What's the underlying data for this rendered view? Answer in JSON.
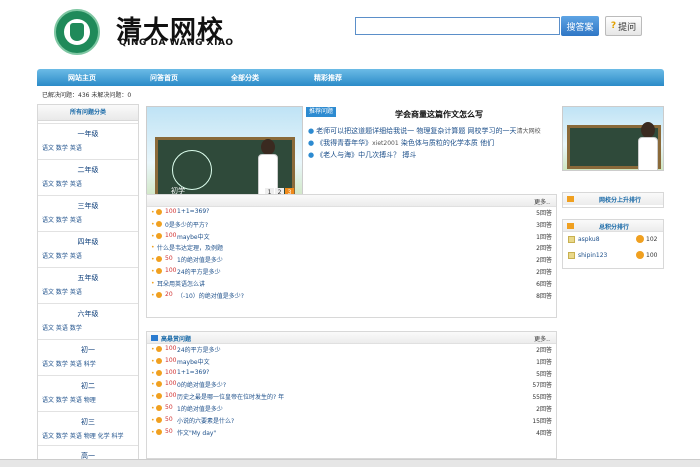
{
  "header": {
    "brand_cn": "清大网校",
    "brand_en": "QING DA WANG XIAO",
    "search_placeholder": "",
    "search_button": "搜答案",
    "ask_button": "提问"
  },
  "nav": [
    "网站主页",
    "问答首页",
    "全部分类",
    "精彩推荐"
  ],
  "stats": "已解决问题：436  未解决问题：0",
  "sidebar": {
    "title": "所有问题分类",
    "grades": [
      {
        "name": "一年级",
        "subjects": "语文 数学 英语"
      },
      {
        "name": "二年级",
        "subjects": "语文 数学 英语"
      },
      {
        "name": "三年级",
        "subjects": "语文 数学 英语"
      },
      {
        "name": "四年级",
        "subjects": "语文 数学 英语"
      },
      {
        "name": "五年级",
        "subjects": "语文 数学 英语"
      },
      {
        "name": "六年级",
        "subjects": "语文 英语 数学"
      },
      {
        "name": "初一",
        "subjects": "语文 数学 英语 科学"
      },
      {
        "name": "初二",
        "subjects": "语文 数学 英语 物理"
      },
      {
        "name": "初三",
        "subjects": "语文 数学 英语 物理 化学 科学"
      },
      {
        "name": "高一",
        "subjects": ""
      }
    ]
  },
  "banner": {
    "caption": "初学",
    "pages": [
      "1",
      "2",
      "3"
    ]
  },
  "recommend": {
    "tag": "推荐问题",
    "title": "学会商量这篇作文怎么写",
    "lines": [
      {
        "text": "老师可以把这道题详细给我说一 物理复杂计算题 网校学习的一天",
        "extra": "清大网校"
      },
      {
        "text": "《我得青春年华》",
        "extra": "xiet2001",
        "text2": "染色体与质粒的化学本质 他们"
      },
      {
        "text": "《老人与海》中几次搏斗？ 搏斗",
        "extra": "",
        "text2": ""
      }
    ]
  },
  "list1": {
    "more": "更多..",
    "rows": [
      {
        "points": "100",
        "q": "1+1=369?",
        "answers": "5回答",
        "coin": true
      },
      {
        "points": "",
        "q": "0是多少的平方?",
        "answers": "3回答",
        "coin": true
      },
      {
        "points": "100",
        "q": "maybe中文",
        "answers": "1回答",
        "coin": true
      },
      {
        "points": "",
        "q": "什么是韦达定理，及例题",
        "answers": "2回答",
        "coin": false
      },
      {
        "points": "50",
        "q": "1的绝对值是多少",
        "answers": "2回答",
        "coin": true
      },
      {
        "points": "100",
        "q": "24的平方是多少",
        "answers": "2回答",
        "coin": true
      },
      {
        "points": "",
        "q": "耳朵用英语怎么讲",
        "answers": "6回答",
        "coin": false
      },
      {
        "points": "20",
        "q": "（-10）的绝对值是多少?",
        "answers": "8回答",
        "coin": true
      }
    ]
  },
  "list2": {
    "title": "高悬赏问题",
    "more": "更多..",
    "rows": [
      {
        "points": "100",
        "q": "24的平方是多少",
        "answers": "2回答"
      },
      {
        "points": "100",
        "q": "maybe中文",
        "answers": "1回答"
      },
      {
        "points": "100",
        "q": "1+1=369?",
        "answers": "5回答"
      },
      {
        "points": "100",
        "q": "0的绝对值是多少?",
        "answers": "57回答"
      },
      {
        "points": "100",
        "q": "历史之最是哪一位皇帝在位时发生的? 年",
        "answers": "55回答"
      },
      {
        "points": "50",
        "q": "1的绝对值是多少",
        "answers": "2回答"
      },
      {
        "points": "50",
        "q": "小说的六要素是什么?",
        "answers": "15回答"
      },
      {
        "points": "50",
        "q": "作文\"My day\"",
        "answers": "4回答"
      }
    ]
  },
  "right": {
    "weekly_title": "网校分上升排行",
    "total_title": "总积分排行",
    "users": [
      {
        "name": "aspku8",
        "score": "102"
      },
      {
        "name": "shipin123",
        "score": "100"
      }
    ]
  }
}
